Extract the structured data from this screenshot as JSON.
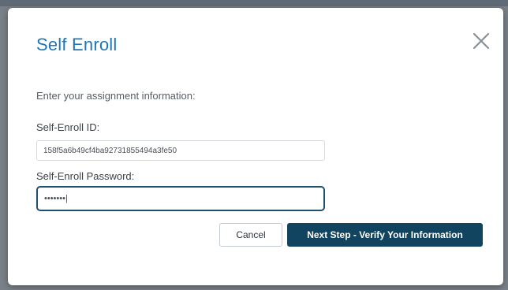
{
  "dialog": {
    "title": "Self Enroll",
    "close_icon": "close-icon",
    "instructions": "Enter your assignment information:",
    "enroll_id_label": "Self-Enroll ID:",
    "enroll_id_value": "158f5a6b49cf4ba92731855494a3fe50",
    "password_label": "Self-Enroll Password:",
    "password_value": "•••••••|",
    "cancel_label": "Cancel",
    "next_label": "Next Step - Verify Your Information"
  },
  "colors": {
    "title": "#1f76b6",
    "primary_button": "#11445e",
    "focus_border": "#1d4f6e"
  }
}
